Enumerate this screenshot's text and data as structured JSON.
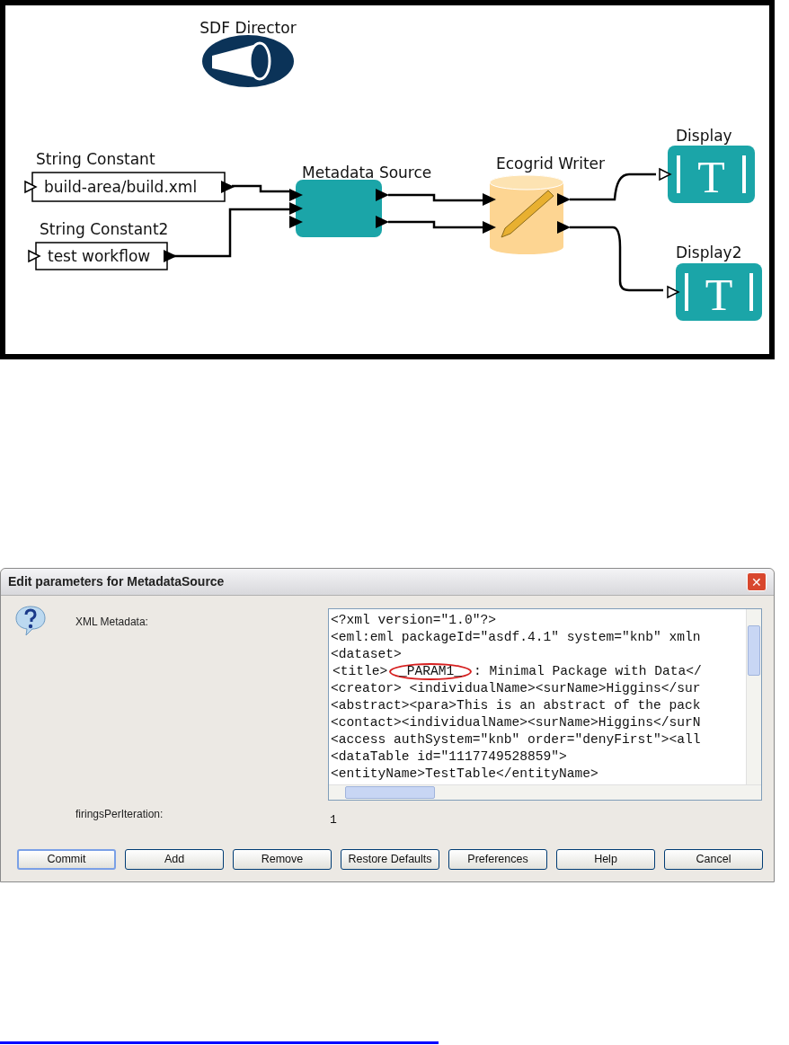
{
  "workflow": {
    "director": {
      "label": "SDF Director"
    },
    "actors": [
      {
        "kind": "string_constant",
        "label": "String Constant",
        "value": "build-area/build.xml"
      },
      {
        "kind": "string_constant",
        "label": "String Constant2",
        "value": "test workflow"
      },
      {
        "kind": "metadata_source",
        "label": "Metadata Source"
      },
      {
        "kind": "ecogrid_writer",
        "label": "Ecogrid Writer"
      },
      {
        "kind": "display",
        "label": "Display",
        "glyph": "T"
      },
      {
        "kind": "display",
        "label": "Display2",
        "glyph": "T"
      }
    ]
  },
  "dialog": {
    "title": "Edit parameters for MetadataSource",
    "close_glyph": "✕",
    "parameters": [
      {
        "kind": "textarea",
        "label": "XML Metadata:",
        "lines": [
          "<?xml version=\"1.0\"?>",
          "<eml:eml packageId=\"asdf.4.1\" system=\"knb\" xmln",
          "<dataset>",
          {
            "segments": [
              {
                "text": "<title>",
                "circled": false
              },
              {
                "text": " _PARAM1_ ",
                "circled": true
              },
              {
                "text": ": Minimal Package with Data</",
                "circled": false
              }
            ]
          },
          "<creator> <individualName><surName>Higgins</sur",
          "<abstract><para>This is an abstract of the pack",
          "<contact><individualName><surName>Higgins</surN",
          "<access authSystem=\"knb\" order=\"denyFirst\"><all",
          "<dataTable id=\"1117749528859\">",
          "<entityName>TestTable</entityName>"
        ]
      },
      {
        "kind": "value",
        "label": "firingsPerIteration:",
        "value": "1"
      }
    ],
    "buttons": [
      {
        "label": "Commit",
        "focused": true
      },
      {
        "label": "Add",
        "focused": false
      },
      {
        "label": "Remove",
        "focused": false
      },
      {
        "label": "Restore Defaults",
        "focused": false
      },
      {
        "label": "Preferences",
        "focused": false
      },
      {
        "label": "Help",
        "focused": false
      },
      {
        "label": "Cancel",
        "focused": false
      }
    ]
  }
}
